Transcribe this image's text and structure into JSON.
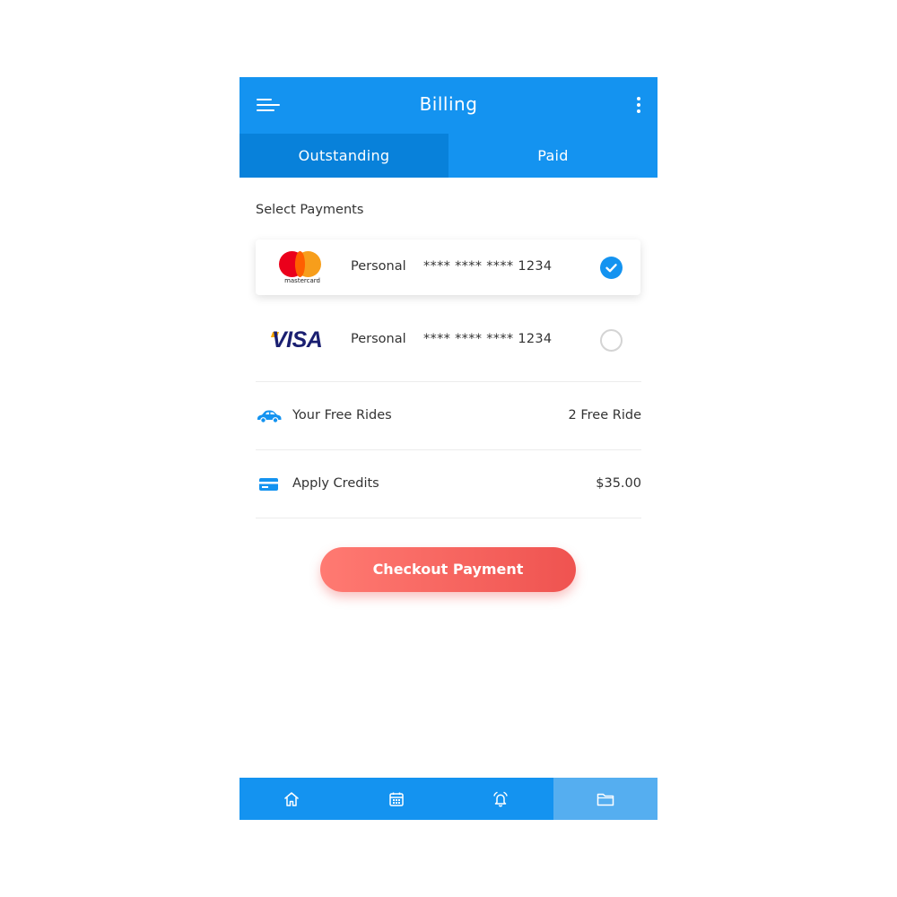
{
  "header": {
    "title": "Billing",
    "menu_icon": "hamburger-menu-icon",
    "more_icon": "more-vertical-icon"
  },
  "tabs": [
    {
      "label": "Outstanding",
      "active": true
    },
    {
      "label": "Paid",
      "active": false
    }
  ],
  "section_label": "Select Payments",
  "payments": [
    {
      "brand": "mastercard",
      "brand_text": "mastercard",
      "type": "Personal",
      "number": "**** **** **** 1234",
      "selected": true
    },
    {
      "brand": "visa",
      "brand_text": "VISA",
      "type": "Personal",
      "number": "**** **** **** 1234",
      "selected": false
    }
  ],
  "extras": [
    {
      "icon": "car-icon",
      "label": "Your Free Rides",
      "value": "2 Free Ride"
    },
    {
      "icon": "credit-card-icon",
      "label": "Apply Credits",
      "value": "$35.00"
    }
  ],
  "checkout_label": "Checkout Payment",
  "bottom_nav": [
    {
      "icon": "home-icon",
      "active": false
    },
    {
      "icon": "calendar-icon",
      "active": false
    },
    {
      "icon": "alarm-bell-icon",
      "active": false
    },
    {
      "icon": "folder-icon",
      "active": true
    }
  ],
  "colors": {
    "primary": "#1493f0",
    "tab_active": "#0881da",
    "checkout_start": "#ff7a72",
    "checkout_end": "#ef5350"
  }
}
